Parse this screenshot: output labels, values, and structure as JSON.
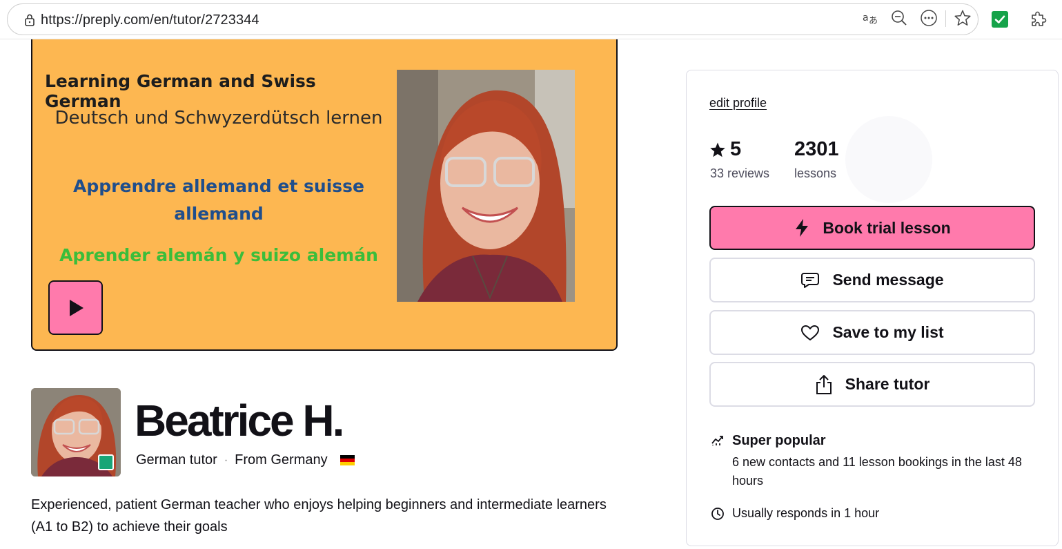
{
  "browser": {
    "url": "https://preply.com/en/tutor/2723344",
    "icons": [
      "lock-icon",
      "translate-icon",
      "zoom-out-icon",
      "more-icon",
      "favorite-star-icon",
      "extension-check-icon",
      "extensions-puzzle-icon"
    ]
  },
  "video": {
    "line1": "Learning German and Swiss German",
    "line2": "Deutsch und Schwyzerdütsch lernen",
    "line3": "Apprendre allemand et suisse allemand",
    "line4": "Aprender alemán y suizo alemán",
    "play_icon": "play-icon",
    "colors": {
      "background": "#fdb751",
      "french": "#1f4e8c",
      "spanish": "#3bbd3b",
      "play_button": "#ff7aac"
    }
  },
  "tutor": {
    "name": "Beatrice H.",
    "subject": "German tutor",
    "separator": "·",
    "origin": "From Germany",
    "flag": "germany-flag-icon",
    "description": "Experienced, patient German teacher who enjoys helping beginners and intermediate learners (A1 to B2) to achieve their goals",
    "online_status_color": "#18a577"
  },
  "sidebar": {
    "edit_label": "edit profile",
    "rating": {
      "value": "5",
      "label": "33 reviews",
      "icon": "star-icon"
    },
    "lessons": {
      "value": "2301",
      "label": "lessons"
    },
    "buttons": {
      "book": {
        "label": "Book trial lesson",
        "icon": "lightning-icon",
        "color": "#ff7aac"
      },
      "message": {
        "label": "Send message",
        "icon": "message-icon"
      },
      "save": {
        "label": "Save to my list",
        "icon": "heart-icon"
      },
      "share": {
        "label": "Share tutor",
        "icon": "share-icon"
      }
    },
    "popular": {
      "title": "Super popular",
      "text": "6 new contacts and 11 lesson bookings in the last 48 hours",
      "icon": "trending-icon"
    },
    "response": {
      "text": "Usually responds in 1 hour",
      "icon": "clock-icon"
    }
  }
}
